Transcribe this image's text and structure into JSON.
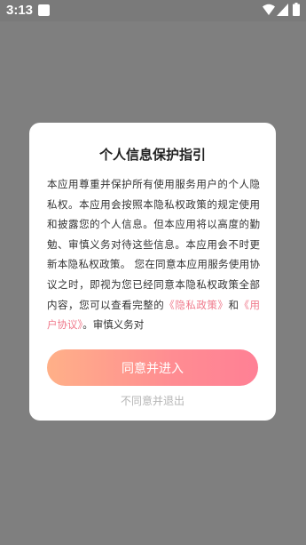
{
  "status_bar": {
    "time": "3:13",
    "icons": [
      "notification-icon",
      "wifi-icon",
      "signal-icon",
      "battery-icon"
    ]
  },
  "dialog": {
    "title": "个人信息保护指引",
    "body_text": "本应用尊重并保护所有使用服务用户的个人隐私权。本应用会按照本隐私权政策的规定使用和披露您的个人信息。但本应用将以高度的勤勉、审慎义务对待这些信息。本应用会不时更新本隐私权政策。 您在同意本应用服务使用协议之时，即视为您已经同意本隐私权政策全部内容，您可以查看完整的",
    "privacy_link": "《隐私政策》",
    "connector": "和",
    "agreement_link": "《用户协议》",
    "tail_text": "。审慎义务对",
    "agree_button": "同意并进入",
    "disagree_link": "不同意并退出"
  },
  "colors": {
    "overlay": "#7f7f7f",
    "link": "#f07a8c",
    "button_start": "#ffb088",
    "button_end": "#ff8095",
    "disagree_text": "#b5b5b5"
  }
}
